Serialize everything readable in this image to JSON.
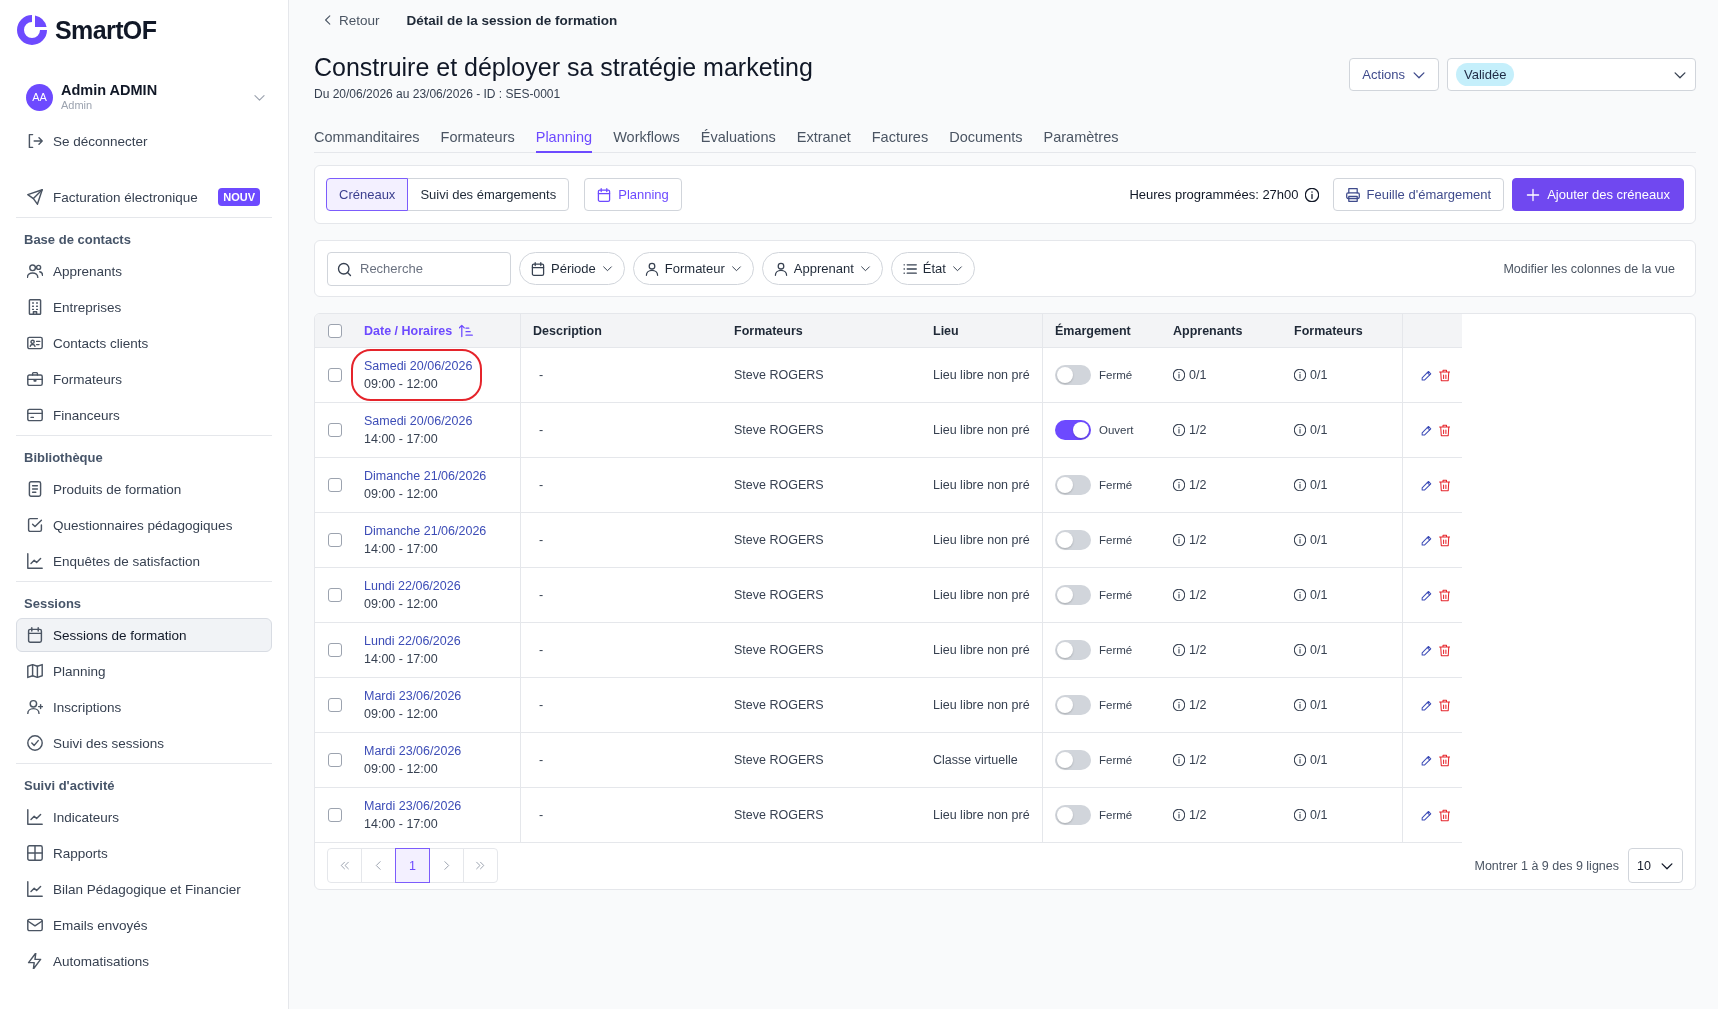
{
  "sidebar": {
    "logo": "SmartOF",
    "user": {
      "initials": "AA",
      "name": "Admin ADMIN",
      "role": "Admin"
    },
    "logout": "Se déconnecter",
    "featured": {
      "label": "Facturation électronique",
      "badge": "NOUV"
    },
    "sections": [
      {
        "title": "Base de contacts",
        "items": [
          {
            "label": "Apprenants",
            "selected": false
          },
          {
            "label": "Entreprises",
            "selected": false
          },
          {
            "label": "Contacts clients",
            "selected": false
          },
          {
            "label": "Formateurs",
            "selected": false
          },
          {
            "label": "Financeurs",
            "selected": false
          }
        ]
      },
      {
        "title": "Bibliothèque",
        "items": [
          {
            "label": "Produits de formation",
            "selected": false
          },
          {
            "label": "Questionnaires pédagogiques",
            "selected": false
          },
          {
            "label": "Enquêtes de satisfaction",
            "selected": false
          }
        ]
      },
      {
        "title": "Sessions",
        "items": [
          {
            "label": "Sessions de formation",
            "selected": true
          },
          {
            "label": "Planning",
            "selected": false
          },
          {
            "label": "Inscriptions",
            "selected": false
          },
          {
            "label": "Suivi des sessions",
            "selected": false
          }
        ]
      },
      {
        "title": "Suivi d'activité",
        "items": [
          {
            "label": "Indicateurs",
            "selected": false
          },
          {
            "label": "Rapports",
            "selected": false
          },
          {
            "label": "Bilan Pédagogique et Financier",
            "selected": false
          },
          {
            "label": "Emails envoyés",
            "selected": false
          },
          {
            "label": "Automatisations",
            "selected": false
          }
        ]
      }
    ]
  },
  "breadcrumb": {
    "back": "Retour",
    "title": "Détail de la session de formation"
  },
  "header": {
    "title": "Construire et déployer sa stratégie marketing",
    "subtitle": "Du 20/06/2026 au 23/06/2026 - ID : SES-0001",
    "actions_button": "Actions",
    "status": "Validée"
  },
  "tabs": [
    {
      "label": "Commanditaires",
      "selected": false
    },
    {
      "label": "Formateurs",
      "selected": false
    },
    {
      "label": "Planning",
      "selected": true
    },
    {
      "label": "Workflows",
      "selected": false
    },
    {
      "label": "Évaluations",
      "selected": false
    },
    {
      "label": "Extranet",
      "selected": false
    },
    {
      "label": "Factures",
      "selected": false
    },
    {
      "label": "Documents",
      "selected": false
    },
    {
      "label": "Paramètres",
      "selected": false
    }
  ],
  "toolbar": {
    "views": [
      {
        "label": "Créneaux",
        "selected": true
      },
      {
        "label": "Suivi des émargements",
        "selected": false
      }
    ],
    "planning_button": "Planning",
    "hours": "Heures programmées: 27h00",
    "sheet_button": "Feuille d'émargement",
    "add_button": "Ajouter des créneaux"
  },
  "filters": {
    "search": {
      "placeholder": "Recherche"
    },
    "chips": [
      "Période",
      "Formateur",
      "Apprenant",
      "État"
    ],
    "columns_link": "Modifier les colonnes de la vue"
  },
  "table": {
    "all_checked": false,
    "columns": [
      {
        "label": "Date / Horaires",
        "sorted": true
      },
      {
        "label": "Description",
        "sorted": false
      },
      {
        "label": "Formateurs",
        "sorted": false
      },
      {
        "label": "Lieu",
        "sorted": false
      },
      {
        "label": "Émargement",
        "sorted": false
      },
      {
        "label": "Apprenants",
        "sorted": false
      },
      {
        "label": "Formateurs",
        "sorted": false
      }
    ],
    "rows": [
      {
        "checked": false,
        "highlighted": true,
        "date": "Samedi 20/06/2026",
        "time": "09:00 - 12:00",
        "description": "-",
        "trainers": "Steve ROGERS",
        "place": "Lieu libre non pré",
        "attendance_open": false,
        "attendance_label": "Fermé",
        "learners": "0/1",
        "trainer_count": "0/1"
      },
      {
        "checked": false,
        "highlighted": false,
        "date": "Samedi 20/06/2026",
        "time": "14:00 - 17:00",
        "description": "-",
        "trainers": "Steve ROGERS",
        "place": "Lieu libre non pré",
        "attendance_open": true,
        "attendance_label": "Ouvert",
        "learners": "1/2",
        "trainer_count": "0/1"
      },
      {
        "checked": false,
        "highlighted": false,
        "date": "Dimanche 21/06/2026",
        "time": "09:00 - 12:00",
        "description": "-",
        "trainers": "Steve ROGERS",
        "place": "Lieu libre non pré",
        "attendance_open": false,
        "attendance_label": "Fermé",
        "learners": "1/2",
        "trainer_count": "0/1"
      },
      {
        "checked": false,
        "highlighted": false,
        "date": "Dimanche 21/06/2026",
        "time": "14:00 - 17:00",
        "description": "-",
        "trainers": "Steve ROGERS",
        "place": "Lieu libre non pré",
        "attendance_open": false,
        "attendance_label": "Fermé",
        "learners": "1/2",
        "trainer_count": "0/1"
      },
      {
        "checked": false,
        "highlighted": false,
        "date": "Lundi 22/06/2026",
        "time": "09:00 - 12:00",
        "description": "-",
        "trainers": "Steve ROGERS",
        "place": "Lieu libre non pré",
        "attendance_open": false,
        "attendance_label": "Fermé",
        "learners": "1/2",
        "trainer_count": "0/1"
      },
      {
        "checked": false,
        "highlighted": false,
        "date": "Lundi 22/06/2026",
        "time": "14:00 - 17:00",
        "description": "-",
        "trainers": "Steve ROGERS",
        "place": "Lieu libre non pré",
        "attendance_open": false,
        "attendance_label": "Fermé",
        "learners": "1/2",
        "trainer_count": "0/1"
      },
      {
        "checked": false,
        "highlighted": false,
        "date": "Mardi 23/06/2026",
        "time": "09:00 - 12:00",
        "description": "-",
        "trainers": "Steve ROGERS",
        "place": "Lieu libre non pré",
        "attendance_open": false,
        "attendance_label": "Fermé",
        "learners": "1/2",
        "trainer_count": "0/1"
      },
      {
        "checked": false,
        "highlighted": false,
        "date": "Mardi 23/06/2026",
        "time": "09:00 - 12:00",
        "description": "-",
        "trainers": "Steve ROGERS",
        "place": "Classe virtuelle",
        "attendance_open": false,
        "attendance_label": "Fermé",
        "learners": "1/2",
        "trainer_count": "0/1"
      },
      {
        "checked": false,
        "highlighted": false,
        "date": "Mardi 23/06/2026",
        "time": "14:00 - 17:00",
        "description": "-",
        "trainers": "Steve ROGERS",
        "place": "Lieu libre non pré",
        "attendance_open": false,
        "attendance_label": "Fermé",
        "learners": "1/2",
        "trainer_count": "0/1"
      }
    ]
  },
  "pagination": {
    "pages": [
      {
        "label": "1",
        "selected": true
      }
    ],
    "summary": "Montrer 1 à 9 des 9 lignes",
    "page_size": "10"
  }
}
